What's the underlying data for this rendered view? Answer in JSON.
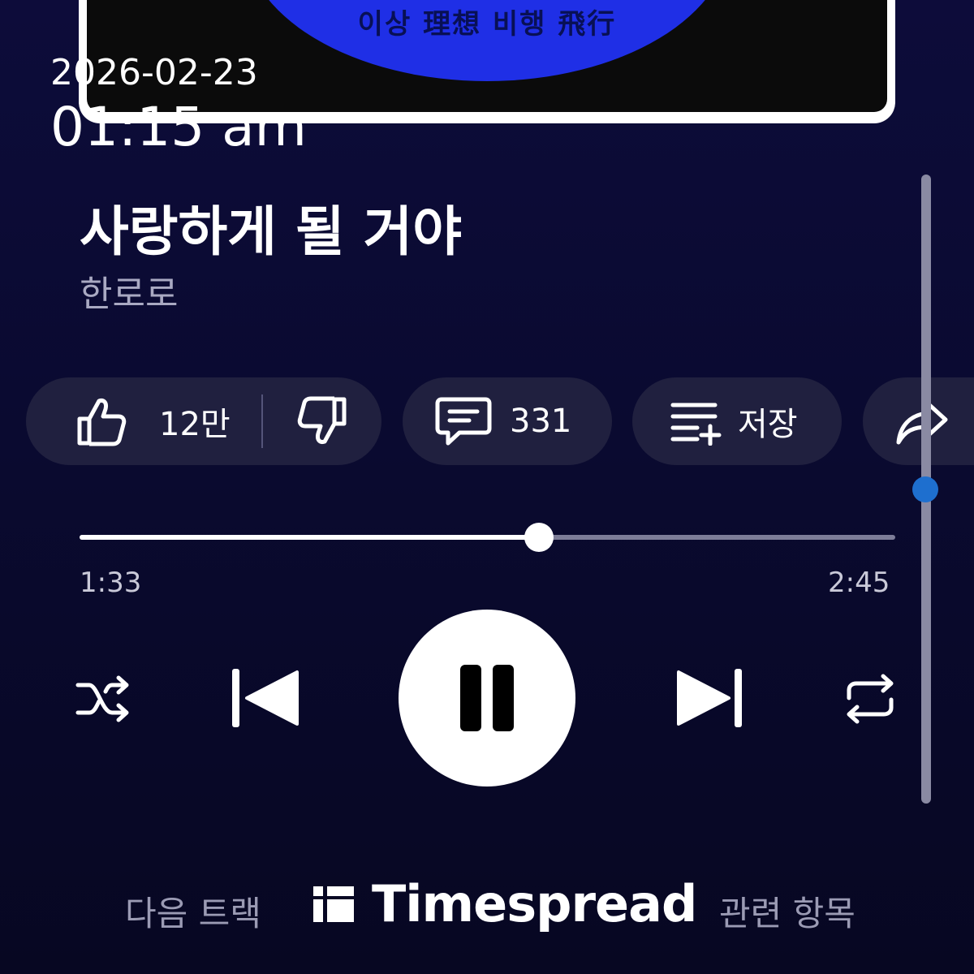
{
  "album": {
    "title_text": "이상 理想 비행 飛行"
  },
  "timestamp": {
    "date": "2026-02-23",
    "time": "01:15 am"
  },
  "track": {
    "title": "사랑하게 될 거야",
    "artist": "한로로"
  },
  "actions": {
    "like_count": "12만",
    "comment_count": "331",
    "save_label": "저장"
  },
  "player": {
    "elapsed": "1:33",
    "duration": "2:45",
    "progress": 0.5636
  },
  "bottom_tabs": {
    "next_track": "다음 트랙",
    "related": "관련 항목"
  },
  "watermark": {
    "text": "Timespread"
  },
  "colors": {
    "background": "#0a0a30",
    "pill": "#20203f",
    "album_disc": "#1f2fe6",
    "scroll_dot": "#1e6fcf"
  }
}
